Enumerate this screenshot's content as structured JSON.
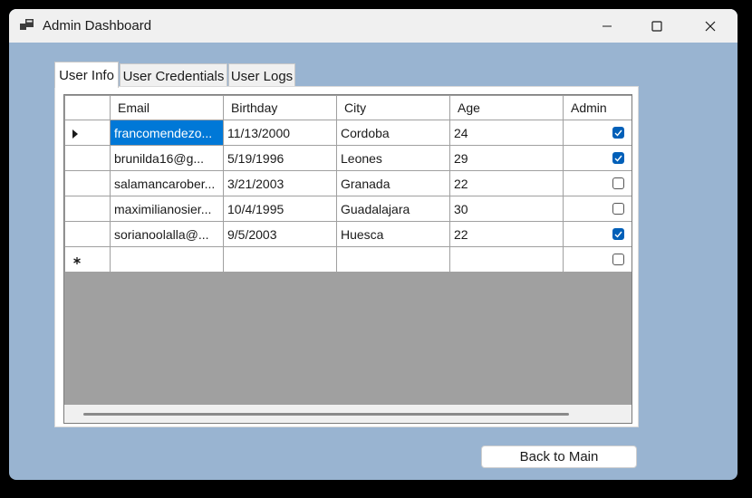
{
  "window": {
    "title": "Admin Dashboard"
  },
  "tabs": [
    {
      "label": "User Info",
      "active": true
    },
    {
      "label": "User Credentials",
      "active": false
    },
    {
      "label": "User Logs",
      "active": false
    }
  ],
  "grid": {
    "columns": [
      "Email",
      "Birthday",
      "City",
      "Age",
      "Admin"
    ],
    "rows": [
      {
        "email": "francomendezo...",
        "birthday": "11/13/2000",
        "city": "Cordoba",
        "age": "24",
        "admin": true,
        "selected": true
      },
      {
        "email": "brunilda16@g...",
        "birthday": "5/19/1996",
        "city": "Leones",
        "age": "29",
        "admin": true
      },
      {
        "email": "salamancarober...",
        "birthday": "3/21/2003",
        "city": "Granada",
        "age": "22",
        "admin": false
      },
      {
        "email": "maximilianosier...",
        "birthday": "10/4/1995",
        "city": "Guadalajara",
        "age": "30",
        "admin": false
      },
      {
        "email": "sorianoolalla@...",
        "birthday": "9/5/2003",
        "city": "Huesca",
        "age": "22",
        "admin": true
      }
    ],
    "new_row_admin": false
  },
  "buttons": {
    "back_label": "Back to Main"
  },
  "colors": {
    "form_background": "#99b4d1",
    "selection": "#0078d7",
    "checkbox_checked": "#005fb8"
  },
  "icons": {
    "app": "app-window-icon",
    "minimize": "minimize-icon",
    "maximize": "maximize-icon",
    "close": "close-icon",
    "current_row": "row-pointer-icon",
    "new_row": "new-row-asterisk-icon"
  }
}
